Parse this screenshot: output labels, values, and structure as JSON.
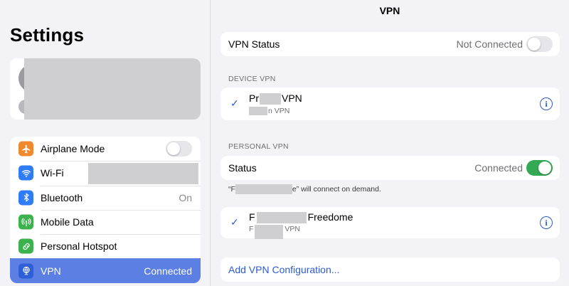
{
  "sidebar": {
    "title": "Settings",
    "items": [
      {
        "label": "Airplane Mode",
        "icon": "airplane-icon",
        "color": "#f0882e",
        "value": ""
      },
      {
        "label": "Wi-Fi",
        "icon": "wifi-icon",
        "color": "#2f7cf6",
        "value": ""
      },
      {
        "label": "Bluetooth",
        "icon": "bluetooth-icon",
        "color": "#2f7cf6",
        "value": "On"
      },
      {
        "label": "Mobile Data",
        "icon": "antenna-icon",
        "color": "#3cb24e",
        "value": ""
      },
      {
        "label": "Personal Hotspot",
        "icon": "hotspot-icon",
        "color": "#3cb24e",
        "value": ""
      },
      {
        "label": "VPN",
        "icon": "globe-icon",
        "color": "#2f5fd6",
        "value": "Connected"
      }
    ]
  },
  "main": {
    "nav_title": "VPN",
    "vpn_status": {
      "label": "VPN Status",
      "value": "Not Connected"
    },
    "device_vpn": {
      "header": "DEVICE VPN",
      "name_prefix": "Pr",
      "name_suffix": "VPN",
      "sub_suffix": "n VPN"
    },
    "personal_vpn": {
      "header": "PERSONAL VPN",
      "status_label": "Status",
      "status_value": "Connected",
      "footnote_prefix": "“F",
      "footnote_suffix": "e” will connect on demand.",
      "entry_name_prefix": "F",
      "entry_name_suffix": "Freedome",
      "entry_sub_prefix": "F",
      "entry_sub_suffix": "VPN"
    },
    "add_config": "Add VPN Configuration..."
  },
  "colors": {
    "accent": "#2d5bd1",
    "selected_row": "#5b7fe3",
    "toggle_on": "#34a853"
  }
}
